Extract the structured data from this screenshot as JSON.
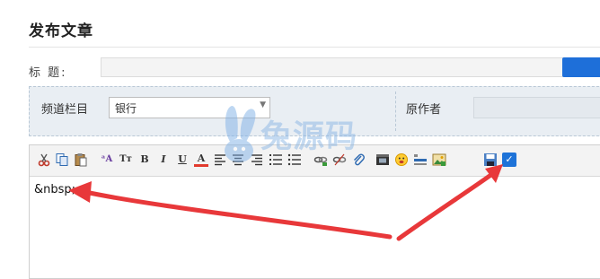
{
  "page": {
    "title": "发布文章"
  },
  "form": {
    "title_label": "标    题:",
    "title_value": "",
    "channel_label": "频道栏目",
    "channel_value": "银行",
    "author_label": "原作者",
    "author_value": ""
  },
  "editor": {
    "content": "&nbsp;",
    "toolbar": [
      {
        "name": "cut-icon",
        "glyph": "✂",
        "color": "#c0392b"
      },
      {
        "name": "copy-icon",
        "glyph": "⧉",
        "color": "#2e6ab1"
      },
      {
        "name": "paste-icon",
        "glyph": "📋",
        "color": "#7a5a2b"
      },
      {
        "name": "font-family-icon",
        "glyph": "ᵃA",
        "color": "#6a3fa0"
      },
      {
        "name": "font-size-icon",
        "glyph": "Tт",
        "color": "#333333"
      },
      {
        "name": "bold-icon",
        "glyph": "B",
        "color": "#333333"
      },
      {
        "name": "italic-icon",
        "glyph": "I",
        "color": "#333333"
      },
      {
        "name": "underline-icon",
        "glyph": "U",
        "color": "#333333"
      },
      {
        "name": "font-color-icon",
        "glyph": "A",
        "color": "#333333"
      },
      {
        "name": "align-left-icon",
        "glyph": "≡",
        "color": "#333333"
      },
      {
        "name": "align-center-icon",
        "glyph": "≡",
        "color": "#333333"
      },
      {
        "name": "align-right-icon",
        "glyph": "≡",
        "color": "#333333"
      },
      {
        "name": "ordered-list-icon",
        "glyph": "⁝≡",
        "color": "#333333"
      },
      {
        "name": "unordered-list-icon",
        "glyph": "⁚≡",
        "color": "#333333"
      },
      {
        "name": "insert-link-icon",
        "glyph": "🔗",
        "color": "#2e6ab1"
      },
      {
        "name": "unlink-icon",
        "glyph": "⛓",
        "color": "#2e6ab1"
      },
      {
        "name": "attachment-icon",
        "glyph": "📎",
        "color": "#2e6ab1"
      },
      {
        "name": "video-icon",
        "glyph": "🎬",
        "color": "#333333"
      },
      {
        "name": "emoticon-icon",
        "glyph": "😊",
        "color": "#e0a000"
      },
      {
        "name": "horizontal-rule-icon",
        "glyph": "▬",
        "color": "#2e6ab1"
      },
      {
        "name": "insert-image-icon",
        "glyph": "🖼",
        "color": "#3a8a3a"
      },
      {
        "name": "save-image-icon",
        "glyph": "💾",
        "color": "#2e6ab1"
      },
      {
        "name": "source-code-checkbox",
        "glyph": "✓",
        "color": "#ffffff"
      }
    ]
  },
  "watermark": {
    "text": "兔源码"
  },
  "colors": {
    "accent_button": "#1e6fd9",
    "annotation_arrow": "#e8383a",
    "watermark": "#8ab6e4"
  }
}
